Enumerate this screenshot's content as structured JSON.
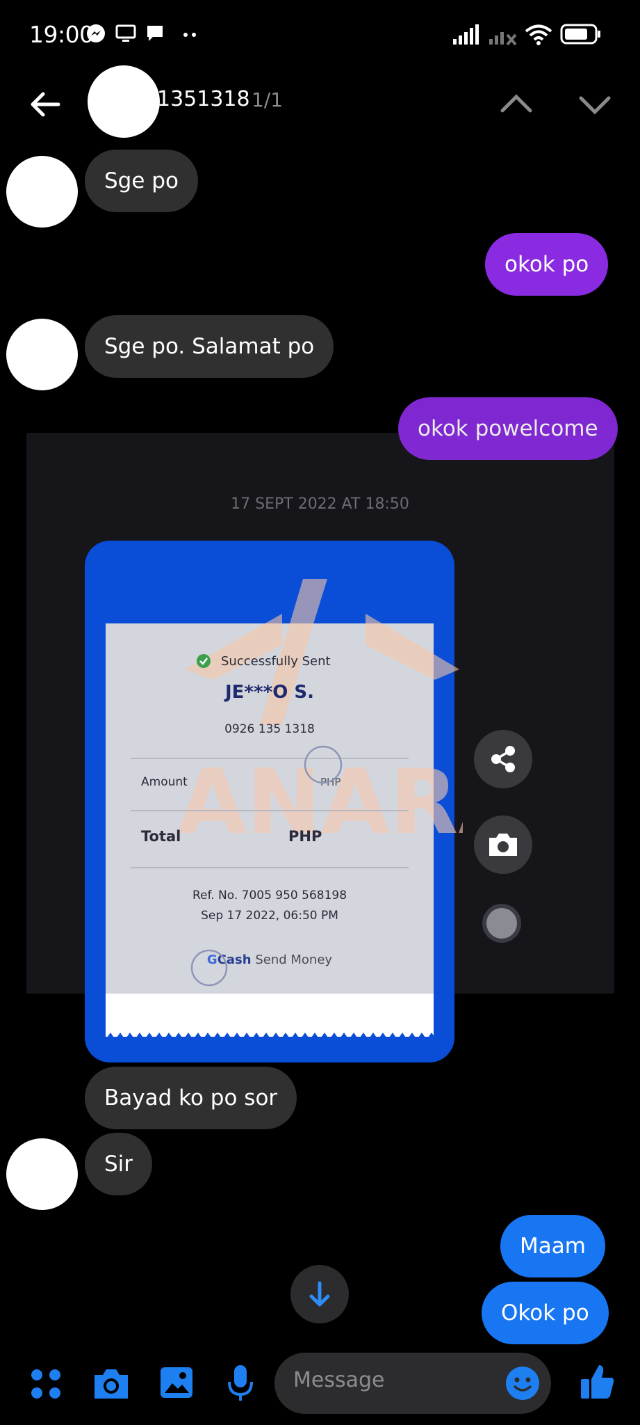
{
  "status_bar": {
    "time": "19:00"
  },
  "header": {
    "contact_name_partial": "1351318",
    "match_count": "1/1"
  },
  "messages": {
    "m1": "Sge po",
    "m2": "okok po",
    "m3": "Sge po. Salamat po",
    "m4": "okok powelcome",
    "m5": "Bayad ko po sor",
    "m6": "Sir",
    "m7": "Maam",
    "m8": "Okok po"
  },
  "receipt": {
    "date_label": "17 SEPT 2022 AT 18:50",
    "status": "Successfully Sent",
    "recipient": "JE***O S.",
    "phone": "0926 135 1318",
    "amount_label": "Amount",
    "amount_currency": "PHP",
    "total_label": "Total",
    "total_currency": "PHP",
    "ref_no": "Ref. No. 7005 950 568198",
    "datetime": "Sep 17 2022, 06:50 PM",
    "brand_g": "G",
    "brand_cash": "Cash",
    "service": "Send Money",
    "watermark": "SANARA"
  },
  "composer": {
    "placeholder": "Message"
  },
  "colors": {
    "outgoing_purple": "#8a2be2",
    "outgoing_blue": "#1976f2",
    "incoming_gray": "#303030",
    "accent_blue": "#1e7ff0"
  },
  "icons": [
    "messenger-icon",
    "screen-icon",
    "chat-icon",
    "signal-icon",
    "wifi-icon",
    "battery-icon",
    "back-arrow-icon",
    "chevron-up-icon",
    "chevron-down-icon",
    "share-icon",
    "camera-icon",
    "scroll-down-icon",
    "apps-icon",
    "gallery-icon",
    "mic-icon",
    "emoji-icon",
    "like-icon"
  ]
}
